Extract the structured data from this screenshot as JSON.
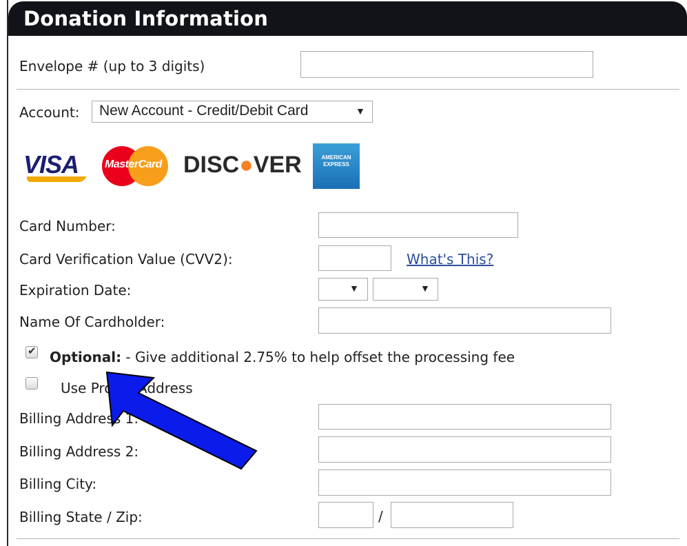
{
  "section": {
    "title": "Donation Information"
  },
  "envelope": {
    "label": "Envelope # (up to 3 digits)",
    "value": ""
  },
  "account": {
    "label": "Account:",
    "selected": "New Account - Credit/Debit Card"
  },
  "card_logos": [
    "VISA",
    "MasterCard",
    "DISCOVER",
    "AMERICAN EXPRESS"
  ],
  "logo_icons": {
    "visa": "visa-logo-icon",
    "mastercard": "mastercard-logo-icon",
    "discover": "discover-logo-icon",
    "amex": "amex-logo-icon"
  },
  "fields": {
    "card_number": {
      "label": "Card Number:",
      "value": ""
    },
    "cvv": {
      "label": "Card Verification Value (CVV2):",
      "value": "",
      "help_link": "What's This?"
    },
    "expiration": {
      "label": "Expiration Date:",
      "month": "",
      "year": ""
    },
    "cardholder": {
      "label": "Name Of Cardholder:",
      "value": ""
    },
    "billing_address1": {
      "label": "Billing Address 1:",
      "value": ""
    },
    "billing_address2": {
      "label": "Billing Address 2:",
      "value": ""
    },
    "billing_city": {
      "label": "Billing City:",
      "value": ""
    },
    "billing_state_zip": {
      "label": "Billing State / Zip:",
      "state": "",
      "separator": "/",
      "zip": ""
    }
  },
  "optional_fee": {
    "checked": true,
    "strong": "Optional:",
    "text": " - Give additional 2.75% to help offset the processing fee"
  },
  "profile_address": {
    "checked": false,
    "text": "Use Pro",
    "text_end": "Address"
  },
  "annotation": {
    "arrow_color": "#0a1bea",
    "icon": "blue-arrow-annotation"
  },
  "colors": {
    "header_bg": "#111318",
    "link": "#2a4d9c"
  }
}
